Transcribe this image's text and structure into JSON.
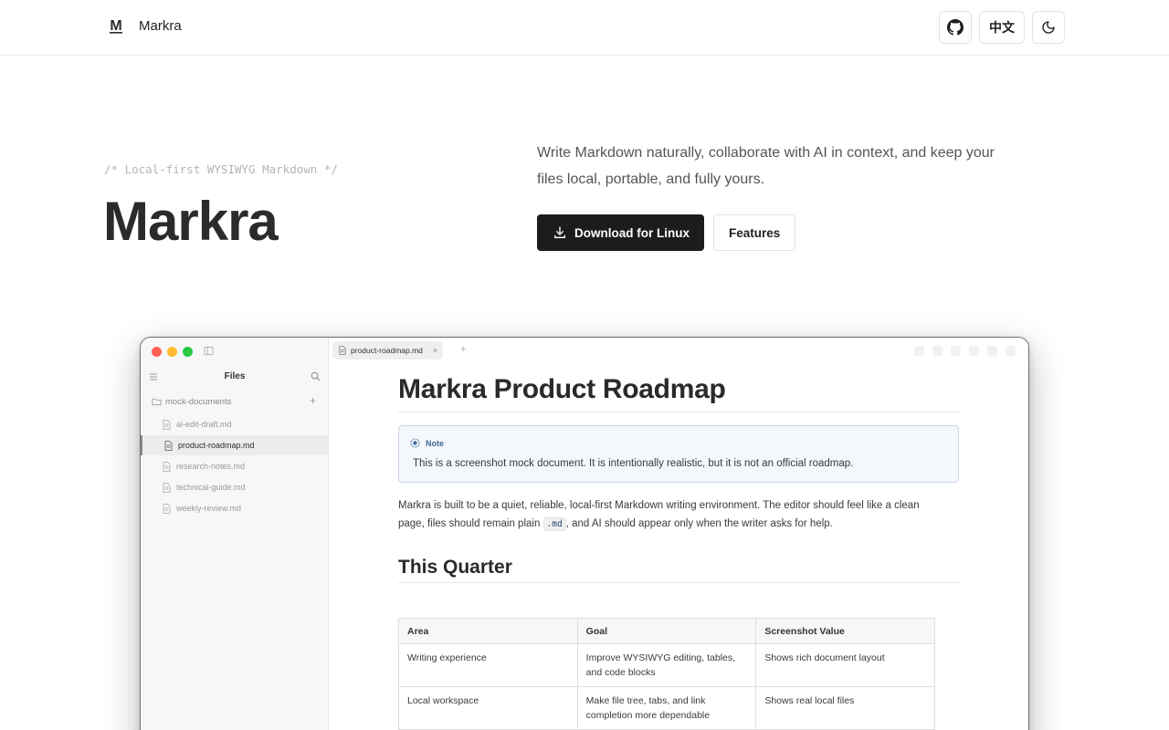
{
  "nav": {
    "brand_name": "Markra",
    "lang_label": "中文",
    "github_icon": "github-icon",
    "theme_icon": "moon-icon"
  },
  "hero": {
    "comment": "/* Local-first WYSIWYG Markdown */",
    "title": "Markra",
    "description": "Write Markdown naturally, collaborate with AI in context, and keep your files local, portable, and fully yours.",
    "download_label": "Download for Linux",
    "features_label": "Features"
  },
  "app": {
    "sidebar": {
      "title": "Files",
      "folder": "mock-documents",
      "files": [
        {
          "name": "ai-edit-draft.md",
          "active": false
        },
        {
          "name": "product-roadmap.md",
          "active": true
        },
        {
          "name": "research-notes.md",
          "active": false
        },
        {
          "name": "technical-guide.md",
          "active": false
        },
        {
          "name": "weekly-review.md",
          "active": false
        }
      ]
    },
    "tab": {
      "label": "product-roadmap.md",
      "close": "×",
      "add": "+"
    },
    "doc": {
      "h1": "Markra Product Roadmap",
      "note_label": "Note",
      "note_text": "This is a screenshot mock document. It is intentionally realistic, but it is not an official roadmap.",
      "para_before_code": "Markra is built to be a quiet, reliable, local-first Markdown writing environment. The editor should feel like a clean page, files should remain plain ",
      "para_code": ".md",
      "para_after_code": ", and AI should appear only when the writer asks for help.",
      "h2": "This Quarter",
      "table": {
        "headers": [
          "Area",
          "Goal",
          "Screenshot Value"
        ],
        "rows": [
          [
            "Writing experience",
            "Improve WYSIWYG editing, tables, and code blocks",
            "Shows rich document layout"
          ],
          [
            "Local workspace",
            "Make file tree, tabs, and link completion more dependable",
            "Shows real local files"
          ]
        ]
      }
    }
  },
  "colors": {
    "primary_button": "#1c1c1c",
    "note_accent": "#3e6896",
    "traffic_red": "#ff5f57",
    "traffic_yellow": "#febc2e",
    "traffic_green": "#28c840"
  }
}
